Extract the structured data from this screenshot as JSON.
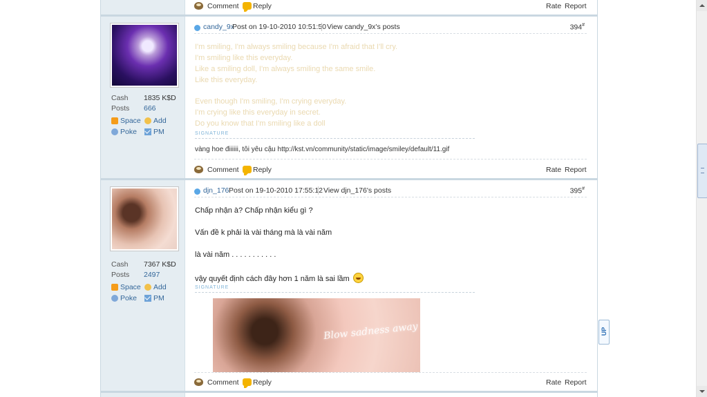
{
  "actions": {
    "comment": "Comment",
    "reply": "Reply",
    "rate": "Rate",
    "report": "Report"
  },
  "user_links": {
    "space": "Space",
    "add": "Add",
    "poke": "Poke",
    "pm": "PM"
  },
  "posts": [
    {
      "author": "candy_9x",
      "time": "Post on 19-10-2010 10:51:50",
      "view_posts": "View candy_9x's posts",
      "floor": "394",
      "cash_label": "Cash",
      "cash": "1835 K$D",
      "posts_label": "Posts",
      "posts": "666",
      "lines": [
        "I'm smiling, I'm always smiling because I'm afraid that I'll cry.",
        "I'm smiling like this everyday.",
        "Like a smiling doll, I'm always smiling the same smile.",
        "Like this everyday.",
        "Even though I'm smiling, I'm crying everyday.",
        "I'm crying like this everyday in secret.",
        "Do you know that I'm smiling like a doll"
      ],
      "signature_label": "SIGNATURE",
      "signature": "vàng hoe điiiiii, tôi yêu cậu http://kst.vn/community/static/image/smiley/default/11.gif"
    },
    {
      "author": "djn_176",
      "time": "Post on 19-10-2010 17:55:12",
      "view_posts": "View djn_176's posts",
      "floor": "395",
      "cash_label": "Cash",
      "cash": "7367 K$D",
      "posts_label": "Posts",
      "posts": "2497",
      "lines": [
        "Chấp nhận à? Chấp nhận kiểu gì ?",
        "Vấn đề k phải là vài tháng mà là vài năm",
        "là vài năm . . . . . . . . . . .",
        "vậy quyết định cách đây hơn 1 năm là sai lầm"
      ],
      "signature_label": "SIGNATURE",
      "signature_image_caption": "Blow sadness away"
    }
  ],
  "up_button": "UP",
  "floor_mark": "#"
}
